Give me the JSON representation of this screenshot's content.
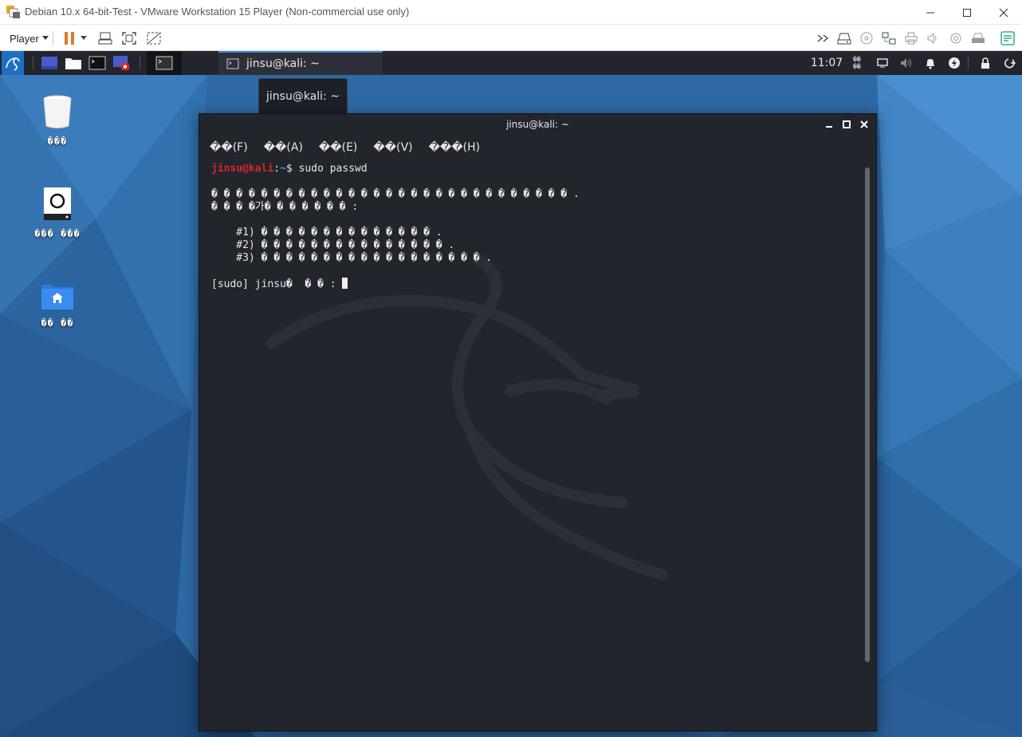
{
  "vmware": {
    "window_title": "Debian 10.x 64-bit-Test - VMware Workstation 15 Player (Non-commercial use only)",
    "player_menu_label": "Player",
    "window_controls": [
      "minimize-icon",
      "maximize-icon",
      "close-icon"
    ],
    "toolbar_left_icons": [
      "pause-icon",
      "dropdown-icon",
      "send-ctrl-alt-del-icon",
      "fullscreen-icon",
      "unity-icon"
    ],
    "toolbar_right_icons": [
      "expand-devices-icon",
      "hard-disk-icon",
      "cd-icon",
      "network-icon",
      "printer-icon",
      "sound-icon",
      "camera-icon",
      "usb-icon",
      "message-log-icon"
    ],
    "colors": {
      "pause": "#e07a2c",
      "message-log": "#2fb08c"
    }
  },
  "panel": {
    "launcher_icons": [
      "kali-menu-icon",
      "workspace-icon",
      "file-manager-icon",
      "terminal-launcher-icon",
      "screen-recorder-icon",
      "active-terminal-icon"
    ],
    "task_label": "jinsu@kali: ~",
    "clock": "11:07",
    "clock_date": "��\n��",
    "tray_icons": [
      "display-icon",
      "volume-icon",
      "notification-bell-icon",
      "power-manager-icon",
      "lock-icon",
      "logout-icon"
    ]
  },
  "tooltip": {
    "text": "jinsu@kali: ~"
  },
  "desktop": {
    "icons": [
      {
        "name": "trash",
        "label": "���"
      },
      {
        "name": "file-system",
        "label": "��� ���"
      },
      {
        "name": "home",
        "label": "�� ��"
      }
    ]
  },
  "terminal": {
    "title": "jinsu@kali: ~",
    "menus": [
      "��(F)",
      "��(A)",
      "��(E)",
      "��(V)",
      "���(H)"
    ],
    "prompt_user": "jinsu@kali",
    "prompt_sep": ":",
    "prompt_path": "~",
    "prompt_dollar": "$",
    "command": " sudo passwd",
    "output": [
      "",
      "� � � � � � � � � � � � � � � � � � � � � � � � � � � � � .",
      "� � � �가� � � � � � � :",
      "",
      "    #1) � � � � � � � � � � � � � � .",
      "    #2) � � � � � � � � � � � � � � � .",
      "    #3) � � � � � � � � � � � � � � � � � � .",
      "",
      "[sudo] jinsu�  � � : "
    ],
    "colors": {
      "prompt_user": "#d8262c",
      "prompt_path": "#4a8cf2",
      "background": "#22252c"
    }
  }
}
